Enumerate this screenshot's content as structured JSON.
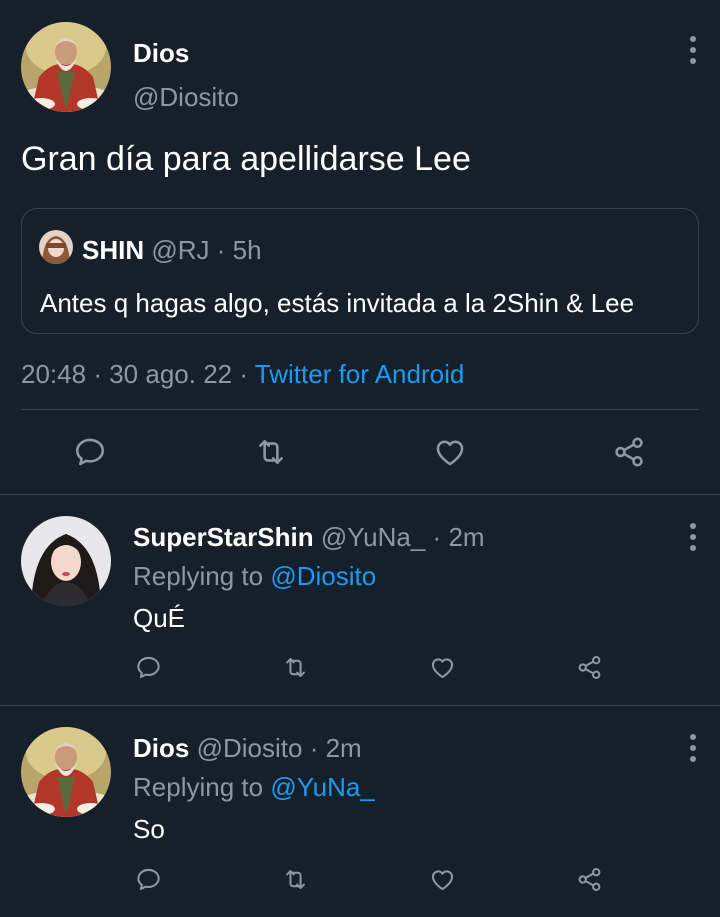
{
  "main_tweet": {
    "author_name": "Dios",
    "author_handle": "@Diosito",
    "text": "Gran día para apellidarse Lee",
    "quoted": {
      "name": "SHIN",
      "handle": "@RJ",
      "sep": "·",
      "time": "5h",
      "text": "Antes q hagas algo, estás invitada a la 2Shin & Lee"
    },
    "time": "20:48",
    "sep1": "·",
    "date": "30 ago. 22",
    "sep2": "·",
    "source": "Twitter for Android"
  },
  "replies": [
    {
      "name": "SuperStarShin",
      "handle": "@YuNa_",
      "sep": "·",
      "time": "2m",
      "replying_label": "Replying to",
      "replying_to": "@Diosito",
      "text": "QuÉ"
    },
    {
      "name": "Dios",
      "handle": "@Diosito",
      "sep": "·",
      "time": "2m",
      "replying_label": "Replying to",
      "replying_to": "@YuNa_",
      "text": "So"
    }
  ],
  "icons": {
    "reply": "reply-icon",
    "retweet": "retweet-icon",
    "like": "heart-icon",
    "share": "share-icon",
    "more": "more-vertical-icon"
  },
  "colors": {
    "background": "#15202b",
    "muted": "#8b98a5",
    "accent": "#1d9bf0",
    "divider": "#38444d"
  }
}
